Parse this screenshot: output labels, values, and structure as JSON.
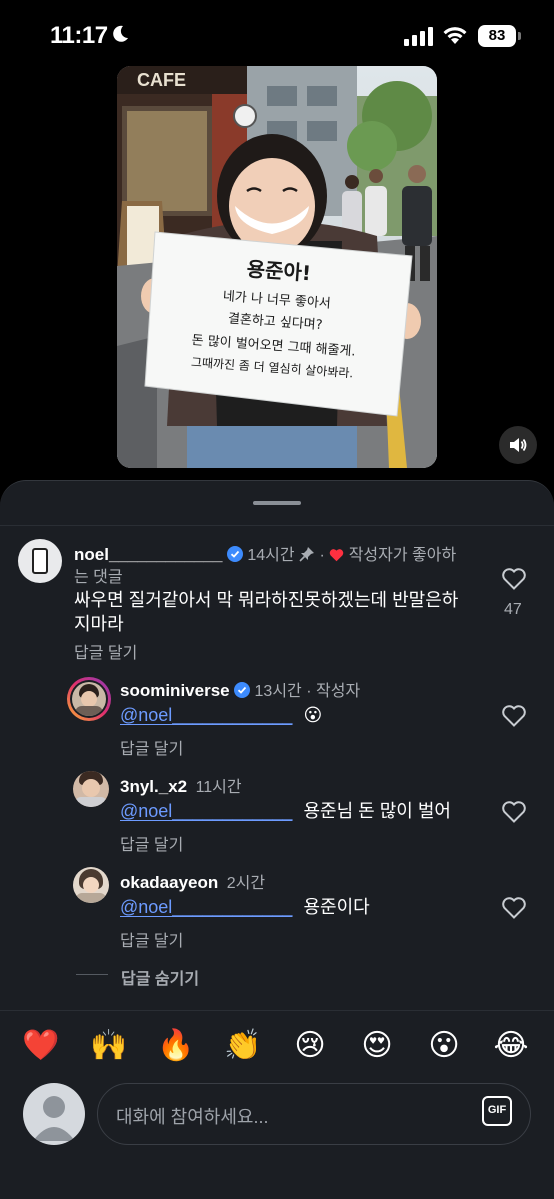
{
  "status_bar": {
    "time": "11:17",
    "battery": "83"
  },
  "video": {
    "sign": {
      "line1": "용준아!",
      "line2": "네가 나 너무 좋아서",
      "line3": "결혼하고 싶다며?",
      "line4": "돈 많이 벌어오면 그때 해줄게.",
      "line5": "그때까진 좀 더 열심히 살아봐라."
    },
    "cafe_sign": "CAFE"
  },
  "comments": [
    {
      "username": "noel____________",
      "time": "14시간",
      "liked_by_author": "작성자가 좋아하",
      "liked_by_author_cont": "는 댓글",
      "text_line1": "싸우면 질거같아서 막 뭐라하진못하겠는데 반말은하",
      "text_line2": "지마라",
      "reply_label": "답글 달기",
      "likes": "47"
    }
  ],
  "replies": [
    {
      "username": "soominiverse",
      "time": "13시간",
      "role": "작성자",
      "mention": "@noel____________",
      "text": "😮",
      "reply_label": "답글 달기"
    },
    {
      "username": "3nyl._x2",
      "time": "11시간",
      "mention": "@noel____________",
      "text": "용준님 돈 많이 벌어",
      "reply_label": "답글 달기"
    },
    {
      "username": "okadaayeon",
      "time": "2시간",
      "mention": "@noel____________",
      "text": "용준이다",
      "reply_label": "답글 달기"
    }
  ],
  "hide_replies": "답글 숨기기",
  "emoji_bar": [
    "❤️",
    "🙌",
    "🔥",
    "👏",
    "😢",
    "😍",
    "😮",
    "😂"
  ],
  "composer": {
    "placeholder": "대화에 참여하세요...",
    "gif_label": "GIF"
  },
  "colors": {
    "sheet_bg": "#1b1e23",
    "mention": "#6d9bff",
    "verified": "#3d8bfd",
    "liked_heart": "#ff3040"
  }
}
